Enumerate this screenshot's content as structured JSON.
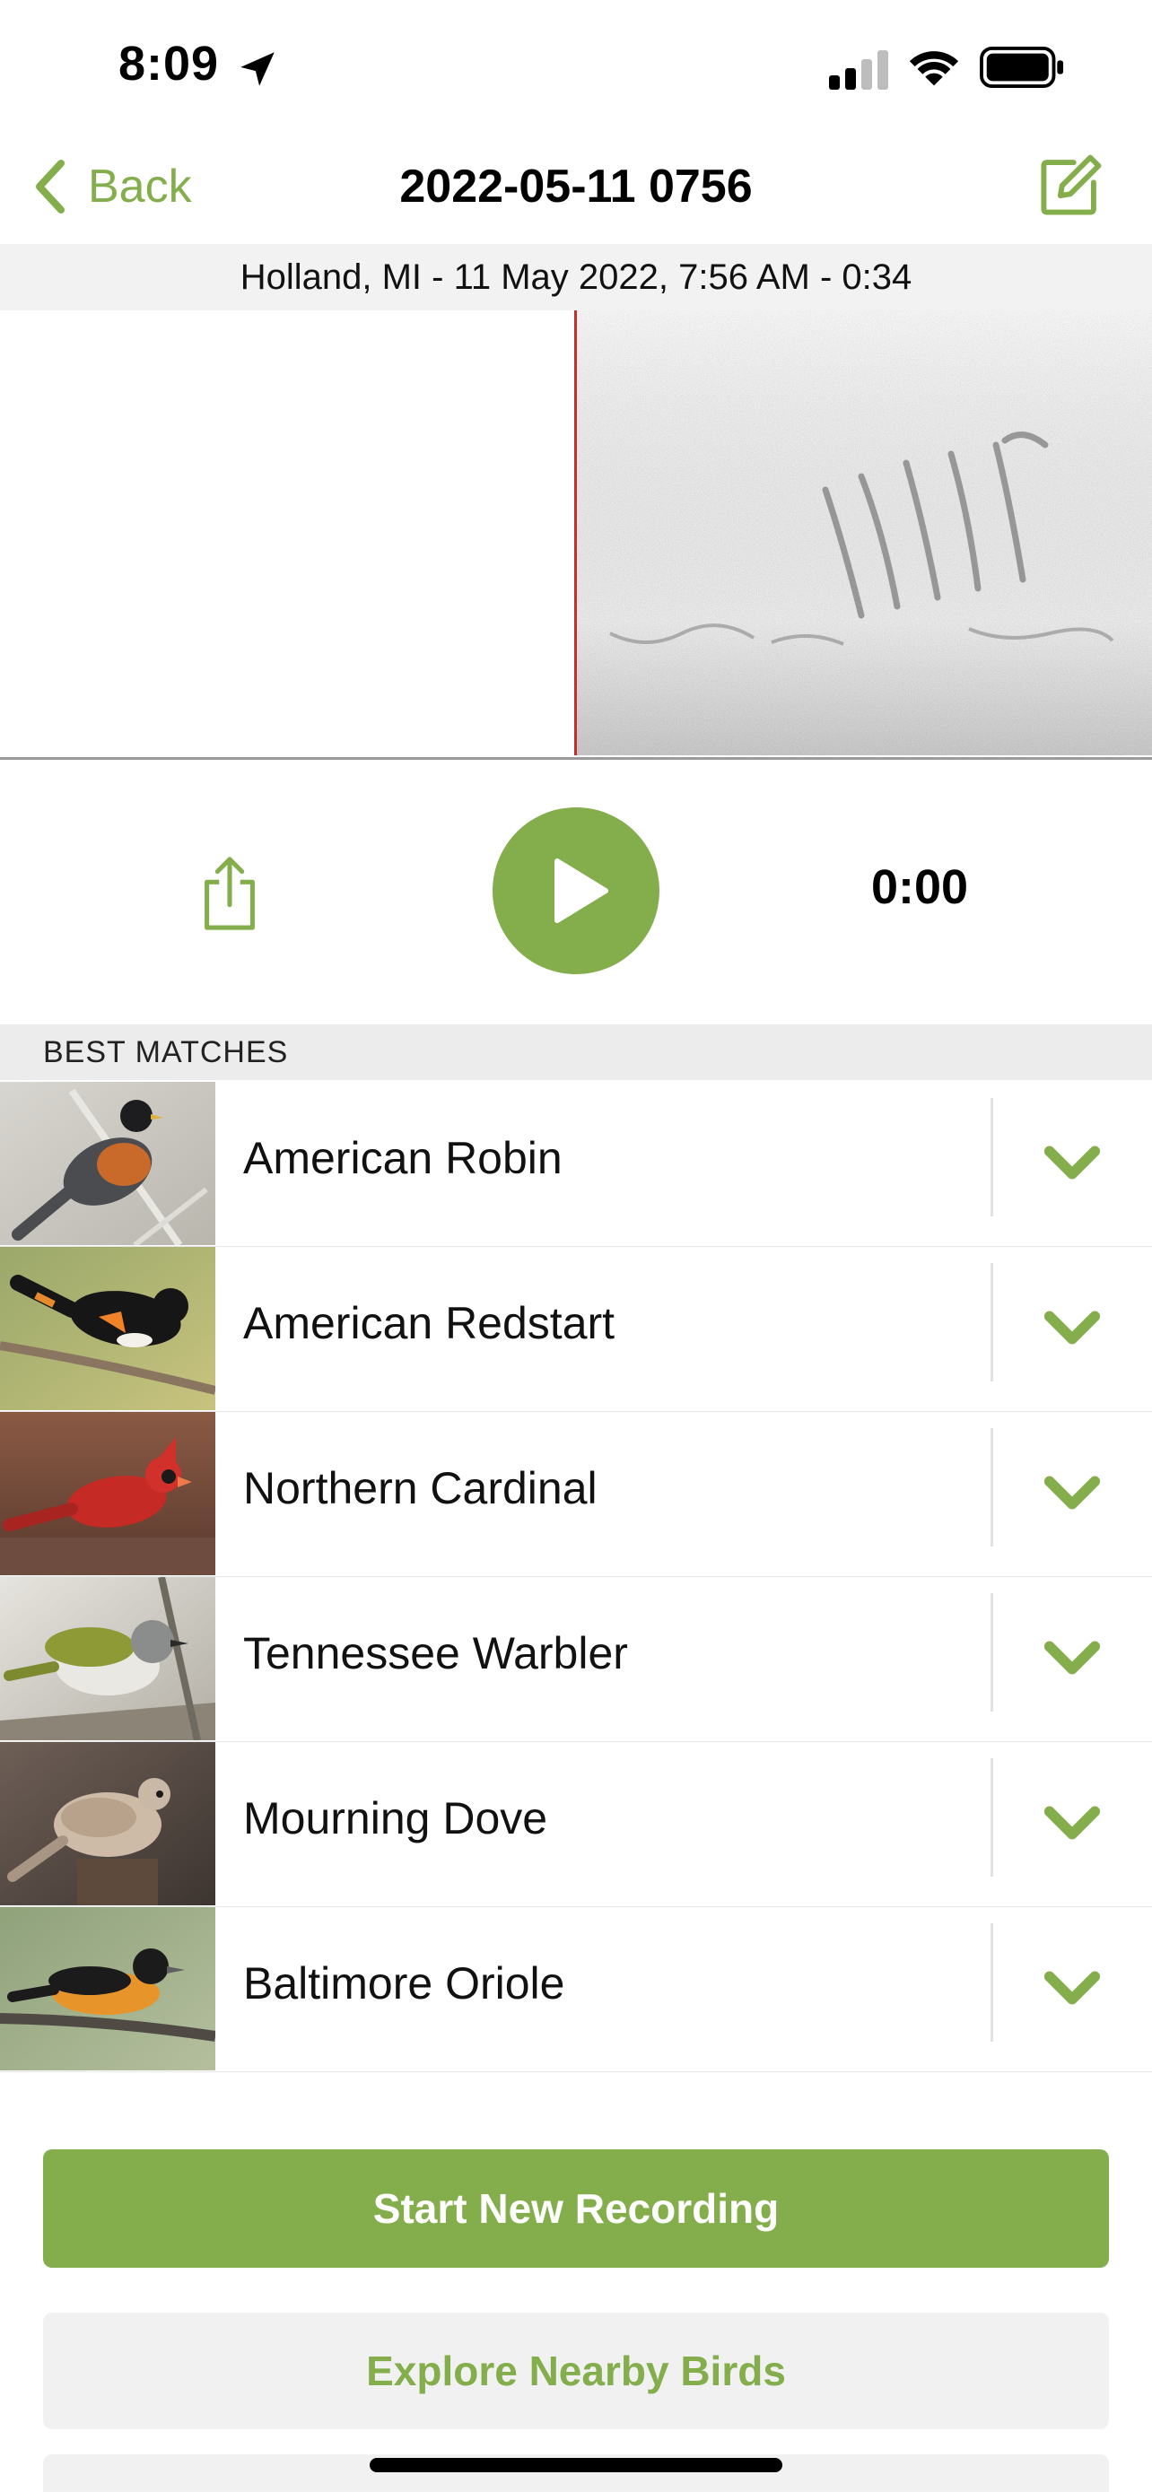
{
  "status_bar": {
    "time": "8:09"
  },
  "nav": {
    "back_label": "Back",
    "title": "2022-05-11 0756"
  },
  "recording_info": "Holland, MI - 11 May 2022, 7:56 AM - 0:34",
  "player": {
    "time": "0:00",
    "progress": 0.0
  },
  "matches": {
    "header": "BEST MATCHES",
    "items": [
      {
        "name": "American Robin"
      },
      {
        "name": "American Redstart"
      },
      {
        "name": "Northern Cardinal"
      },
      {
        "name": "Tennessee Warbler"
      },
      {
        "name": "Mourning Dove"
      },
      {
        "name": "Baltimore Oriole"
      }
    ]
  },
  "actions": {
    "start_recording": "Start New Recording",
    "explore_nearby": "Explore Nearby Birds"
  },
  "colors": {
    "accent": "#84ad4c",
    "playhead": "#c0312b"
  }
}
